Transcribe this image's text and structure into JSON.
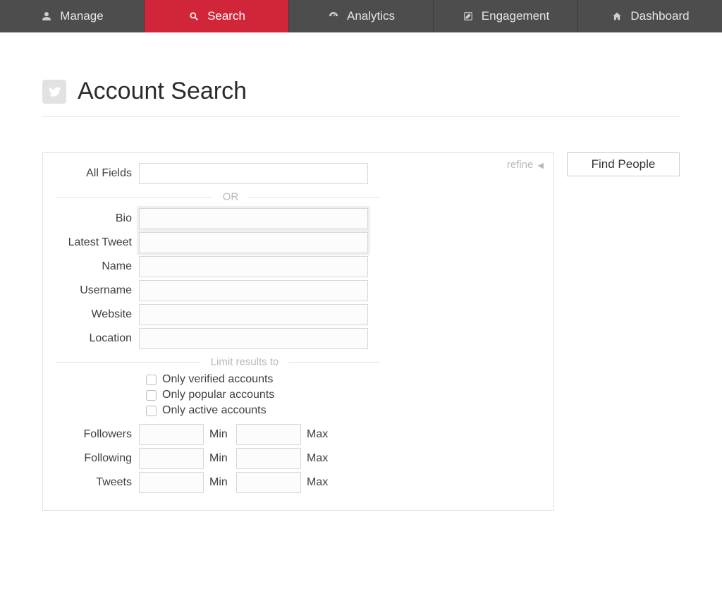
{
  "nav": {
    "items": [
      {
        "label": "Manage",
        "icon": "user-icon"
      },
      {
        "label": "Search",
        "icon": "search-icon",
        "active": true
      },
      {
        "label": "Analytics",
        "icon": "dashboard-icon"
      },
      {
        "label": "Engagement",
        "icon": "edit-icon"
      },
      {
        "label": "Dashboard",
        "icon": "home-icon"
      }
    ]
  },
  "page": {
    "title": "Account Search",
    "refine": "refine",
    "find_people": "Find People"
  },
  "fields": {
    "all_fields": "All Fields",
    "bio": "Bio",
    "latest_tweet": "Latest Tweet",
    "name": "Name",
    "username": "Username",
    "website": "Website",
    "location": "Location"
  },
  "dividers": {
    "or": "OR",
    "limit": "Limit results to"
  },
  "checks": {
    "verified": "Only verified accounts",
    "popular": "Only popular accounts",
    "active": "Only active accounts"
  },
  "ranges": {
    "followers": "Followers",
    "following": "Following",
    "tweets": "Tweets",
    "min": "Min",
    "max": "Max"
  }
}
